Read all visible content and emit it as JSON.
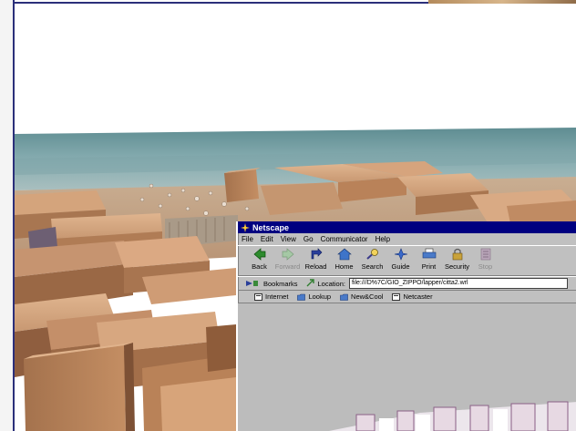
{
  "netscape": {
    "title": "Netscape",
    "menu": [
      "File",
      "Edit",
      "View",
      "Go",
      "Communicator",
      "Help"
    ],
    "toolbar": [
      {
        "label": "Back",
        "icon": "back-arrow-icon",
        "enabled": true
      },
      {
        "label": "Forward",
        "icon": "forward-arrow-icon",
        "enabled": false
      },
      {
        "label": "Reload",
        "icon": "reload-icon",
        "enabled": true
      },
      {
        "label": "Home",
        "icon": "home-icon",
        "enabled": true
      },
      {
        "label": "Search",
        "icon": "search-icon",
        "enabled": true
      },
      {
        "label": "Guide",
        "icon": "guide-icon",
        "enabled": true
      },
      {
        "label": "Print",
        "icon": "print-icon",
        "enabled": true
      },
      {
        "label": "Security",
        "icon": "security-lock-icon",
        "enabled": true
      },
      {
        "label": "Stop",
        "icon": "stop-icon",
        "enabled": false
      }
    ],
    "bookmarks_label": "Bookmarks",
    "location_label": "Location:",
    "location_value": "file:///D%7C/GIO_ZIPPO/lapper/citta2.wrl",
    "personal_toolbar": [
      "Internet",
      "Lookup",
      "New&Cool",
      "Netcaster"
    ]
  },
  "colors": {
    "title_bar": "#000080",
    "chrome": "#c0c0c0",
    "frame_border": "#2b2f7a",
    "sea": "#6f9a9e",
    "buildings": "#c99a73"
  }
}
